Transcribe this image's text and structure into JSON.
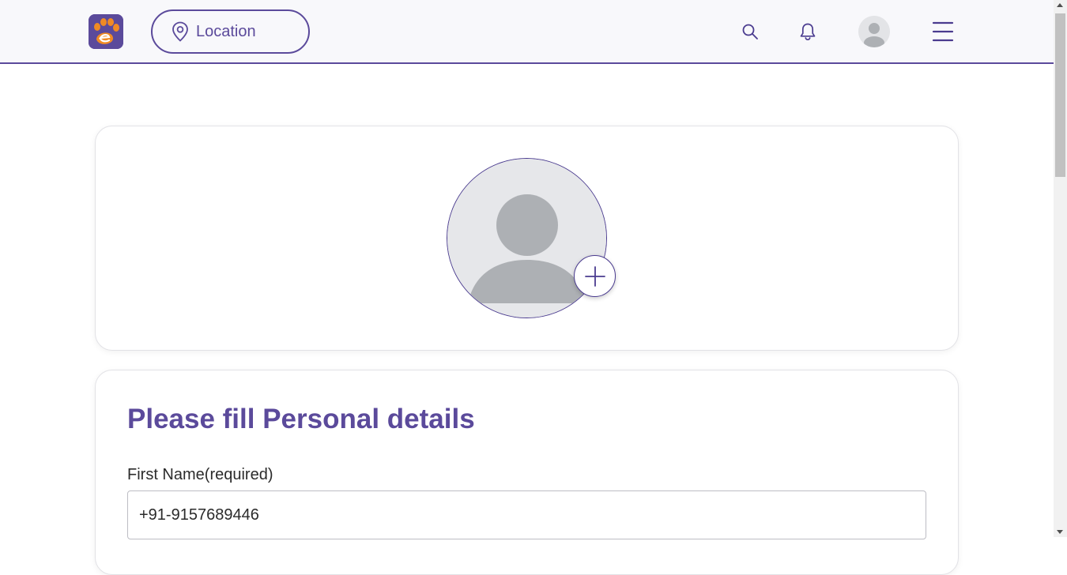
{
  "header": {
    "location_label": "Location",
    "icons": {
      "logo": "paw-logo",
      "location": "map-pin-icon",
      "search": "search-icon",
      "notifications": "bell-icon",
      "profile": "user-avatar-icon",
      "menu": "hamburger-menu-icon"
    }
  },
  "profile_photo": {
    "add_icon": "plus-icon"
  },
  "form": {
    "title": "Please fill Personal details",
    "first_name": {
      "label": "First Name(required)",
      "value": "+91-9157689446"
    }
  },
  "colors": {
    "brand": "#5b4a9b",
    "logo_accent": "#f08a24",
    "avatar_placeholder": "#adb0b4"
  }
}
